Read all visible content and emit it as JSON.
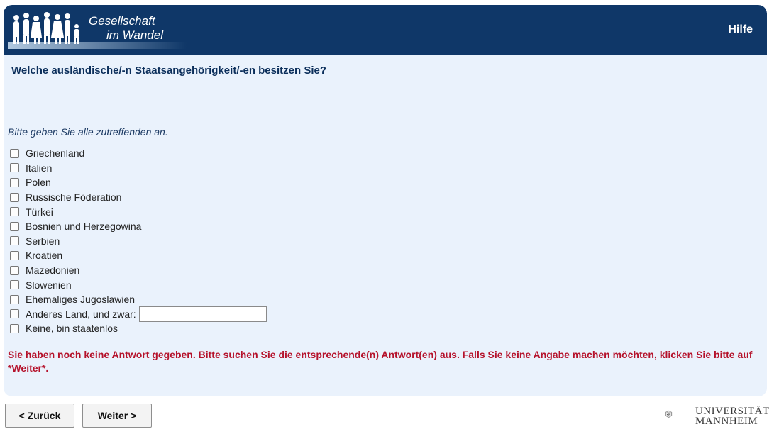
{
  "header": {
    "logo_line1": "Gesellschaft",
    "logo_line2": "im Wandel",
    "help_label": "Hilfe"
  },
  "question": {
    "title": "Welche ausländische/-n Staatsangehörigkeit/-en besitzen Sie?",
    "instruction": "Bitte geben Sie alle zutreffenden an."
  },
  "options": [
    {
      "label": "Griechenland",
      "checked": false
    },
    {
      "label": "Italien",
      "checked": false
    },
    {
      "label": "Polen",
      "checked": false
    },
    {
      "label": "Russische Föderation",
      "checked": false
    },
    {
      "label": "Türkei",
      "checked": false
    },
    {
      "label": "Bosnien und Herzegowina",
      "checked": false
    },
    {
      "label": "Serbien",
      "checked": false
    },
    {
      "label": "Kroatien",
      "checked": false
    },
    {
      "label": "Mazedonien",
      "checked": false
    },
    {
      "label": "Slowenien",
      "checked": false
    },
    {
      "label": "Ehemaliges Jugoslawien",
      "checked": false
    },
    {
      "label": "Anderes Land, und zwar:",
      "checked": false
    },
    {
      "label": "Keine, bin staatenlos",
      "checked": false
    }
  ],
  "other_input": {
    "value": ""
  },
  "error_message": "Sie haben noch keine Antwort gegeben. Bitte suchen Sie die entsprechende(n) Antwort(en) aus. Falls Sie keine Angabe machen möchten, klicken Sie bitte auf *Weiter*.",
  "nav": {
    "back_label": "< Zurück",
    "next_label": "Weiter >"
  },
  "footer": {
    "uni_line1": "UNIVERSITÄT",
    "uni_line2": "MANNHEIM"
  },
  "colors": {
    "header_bg": "#0f3768",
    "panel_bg": "#eaf2fc",
    "error": "#b5122b"
  }
}
